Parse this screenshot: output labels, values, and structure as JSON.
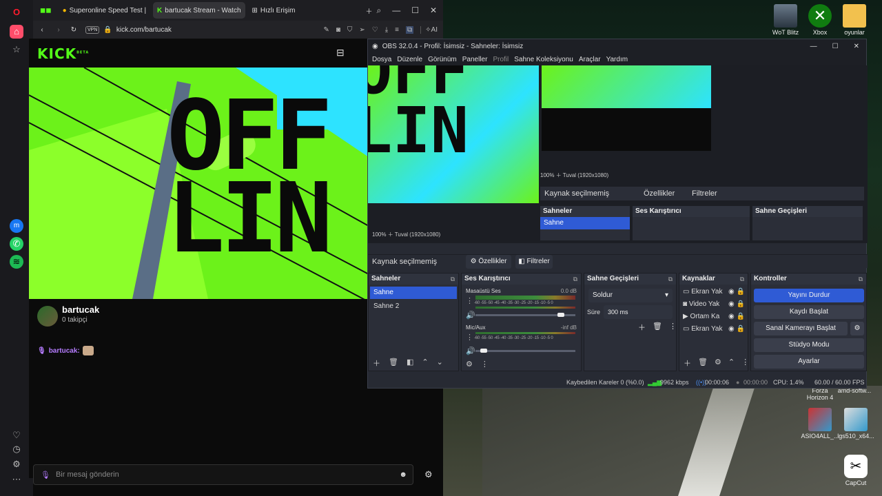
{
  "desktop": {
    "icons": [
      {
        "label": "WoT Blitz"
      },
      {
        "label": "Xbox"
      },
      {
        "label": "oyunlar"
      },
      {
        "label": "Forza Horizon 4"
      },
      {
        "label": "amd-softw..."
      },
      {
        "label": "ASIO4ALL_..."
      },
      {
        "label": "lgs510_x64..."
      },
      {
        "label": "CapCut"
      }
    ]
  },
  "browser": {
    "tabs": [
      {
        "label": "Superonline Speed Test |"
      },
      {
        "label": "bartucak Stream - Watch"
      },
      {
        "label": "Hızlı Erişim"
      }
    ],
    "url": "kick.com/bartucak",
    "vpn": "VPN",
    "ai_label": "AI",
    "kick_logo": "KICK",
    "beta": "BETA",
    "channel": {
      "name": "bartucak",
      "followers": "0 takipçi"
    },
    "chat": {
      "user": "bartucak:",
      "placeholder": "Bir mesaj gönderin"
    },
    "offline_text": "OFF LIN"
  },
  "obs": {
    "title": "OBS 32.0.4 - Profil: İsimsiz - Sahneler: İsimsiz",
    "menu": [
      "Dosya",
      "Düzenle",
      "Görünüm",
      "Paneller",
      "Profil",
      "Sahne Koleksiyonu",
      "Araçlar",
      "Yardım"
    ],
    "no_source": "Kaynak seçilmemiş",
    "properties": "Özellikler",
    "filters": "Filtreler",
    "zoom": "100%",
    "canvas": "Tuval (1920x1080)",
    "scenes": {
      "title": "Sahneler",
      "items": [
        "Sahne",
        "Sahne 2"
      ]
    },
    "mixer": {
      "title": "Ses Karıştırıcı",
      "tracks": [
        {
          "name": "Masaüstü Ses",
          "db": "0.0 dB",
          "level": 0.88
        },
        {
          "name": "Mic/Aux",
          "db": "-inf dB",
          "level": 0.05
        }
      ],
      "ticks": "-60 -55 -50 -45 -40 -35 -30 -25 -20 -15 -10 -5 0"
    },
    "transitions": {
      "title": "Sahne Geçişleri",
      "type": "Soldur",
      "duration_label": "Süre",
      "duration": "300 ms"
    },
    "sources": {
      "title": "Kaynaklar",
      "items": [
        "Ekran Yak",
        "Video Yak",
        "Ortam Ka",
        "Ekran Yak"
      ]
    },
    "controls": {
      "title": "Kontroller",
      "buttons": [
        "Yayını Durdur",
        "Kaydı Başlat",
        "Sanal Kamerayı Başlat",
        "Stüdyo Modu",
        "Ayarlar"
      ]
    },
    "status": {
      "dropped": "Kaybedilen Kareler 0 (%0.0)",
      "bitrate": "9962 kbps",
      "stream_time": "00:00:06",
      "rec_time": "00:00:00",
      "cpu": "CPU: 1.4%",
      "fps": "60.00 / 60.00 FPS"
    }
  },
  "colors": {
    "kick_green": "#53fc18",
    "obs_blue": "#2f5bd5"
  }
}
